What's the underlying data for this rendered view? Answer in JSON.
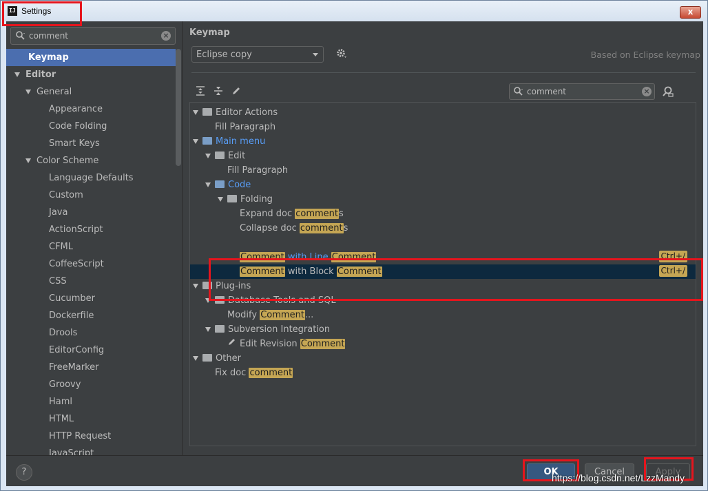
{
  "window": {
    "title": "Settings",
    "app_icon": "IJ",
    "close": "x"
  },
  "sidebar": {
    "search": {
      "value": "comment"
    },
    "items": [
      {
        "label": "Keymap",
        "level": 0,
        "selected": true
      },
      {
        "label": "Editor",
        "level": 0,
        "expanded": true,
        "bold": true
      },
      {
        "label": "General",
        "level": 1,
        "expanded": true
      },
      {
        "label": "Appearance",
        "level": 2
      },
      {
        "label": "Code Folding",
        "level": 2
      },
      {
        "label": "Smart Keys",
        "level": 2
      },
      {
        "label": "Color Scheme",
        "level": 1,
        "expanded": true
      },
      {
        "label": "Language Defaults",
        "level": 2
      },
      {
        "label": "Custom",
        "level": 2
      },
      {
        "label": "Java",
        "level": 2
      },
      {
        "label": "ActionScript",
        "level": 2
      },
      {
        "label": "CFML",
        "level": 2
      },
      {
        "label": "CoffeeScript",
        "level": 2
      },
      {
        "label": "CSS",
        "level": 2
      },
      {
        "label": "Cucumber",
        "level": 2
      },
      {
        "label": "Dockerfile",
        "level": 2
      },
      {
        "label": "Drools",
        "level": 2
      },
      {
        "label": "EditorConfig",
        "level": 2
      },
      {
        "label": "FreeMarker",
        "level": 2
      },
      {
        "label": "Groovy",
        "level": 2
      },
      {
        "label": "Haml",
        "level": 2
      },
      {
        "label": "HTML",
        "level": 2
      },
      {
        "label": "HTTP Request",
        "level": 2
      },
      {
        "label": "JavaScript",
        "level": 2
      }
    ]
  },
  "keymap": {
    "title": "Keymap",
    "scheme": "Eclipse copy",
    "based_on": "Based on Eclipse keymap",
    "search": {
      "value": "comment"
    },
    "tree": [
      {
        "level": 0,
        "expanded": true,
        "icon": "editor",
        "parts": [
          {
            "t": "Editor Actions"
          }
        ]
      },
      {
        "level": 1,
        "parts": [
          {
            "t": "Fill Paragraph"
          }
        ]
      },
      {
        "level": 0,
        "expanded": true,
        "icon": "menu",
        "blue": true,
        "parts": [
          {
            "t": "Main menu"
          }
        ]
      },
      {
        "level": 1,
        "expanded": true,
        "icon": "folder",
        "parts": [
          {
            "t": "Edit"
          }
        ]
      },
      {
        "level": 2,
        "parts": [
          {
            "t": "Fill Paragraph"
          }
        ]
      },
      {
        "level": 1,
        "expanded": true,
        "icon": "folder-blue",
        "blue": true,
        "parts": [
          {
            "t": "Code"
          }
        ]
      },
      {
        "level": 2,
        "expanded": true,
        "icon": "folder",
        "parts": [
          {
            "t": "Folding"
          }
        ]
      },
      {
        "level": 3,
        "parts": [
          {
            "t": "Expand doc "
          },
          {
            "t": "comment",
            "hl": true
          },
          {
            "t": "s"
          }
        ]
      },
      {
        "level": 3,
        "parts": [
          {
            "t": "Collapse doc "
          },
          {
            "t": "comment",
            "hl": true
          },
          {
            "t": "s"
          }
        ]
      },
      {
        "level": 2,
        "spacer": true,
        "parts": []
      },
      {
        "level": 3,
        "parts": [
          {
            "t": "Comment",
            "hl": true
          },
          {
            "t": " with Line ",
            "blue": true
          },
          {
            "t": "Comment",
            "hl": true
          }
        ],
        "shortcut": "Ctrl+/"
      },
      {
        "level": 3,
        "selected": true,
        "parts": [
          {
            "t": "Comment",
            "hl": true
          },
          {
            "t": " with Block "
          },
          {
            "t": "Comment",
            "hl": true
          }
        ],
        "shortcut": "Ctrl+/"
      },
      {
        "level": 0,
        "expanded": true,
        "icon": "folder",
        "parts": [
          {
            "t": "Plug-ins"
          }
        ]
      },
      {
        "level": 1,
        "expanded": true,
        "icon": "folder",
        "parts": [
          {
            "t": "Database Tools and SQL"
          }
        ]
      },
      {
        "level": 2,
        "parts": [
          {
            "t": "Modify "
          },
          {
            "t": "Comment",
            "hl": true
          },
          {
            "t": "..."
          }
        ]
      },
      {
        "level": 1,
        "expanded": true,
        "icon": "folder",
        "parts": [
          {
            "t": "Subversion Integration"
          }
        ]
      },
      {
        "level": 2,
        "icon": "pencil",
        "parts": [
          {
            "t": "Edit Revision "
          },
          {
            "t": "Comment",
            "hl": true
          }
        ]
      },
      {
        "level": 0,
        "expanded": true,
        "icon": "other",
        "parts": [
          {
            "t": "Other"
          }
        ]
      },
      {
        "level": 1,
        "parts": [
          {
            "t": "Fix doc "
          },
          {
            "t": "comment",
            "hl": true
          }
        ]
      }
    ]
  },
  "buttons": {
    "help": "?",
    "ok": "OK",
    "cancel": "Cancel",
    "apply": "Apply"
  },
  "watermark": "https://blog.csdn.net/LzzMandy",
  "colors": {
    "accent": "#4b6eaf",
    "highlight": "#c5a654",
    "annotation": "#e5151d",
    "background": "#3c3f41"
  }
}
